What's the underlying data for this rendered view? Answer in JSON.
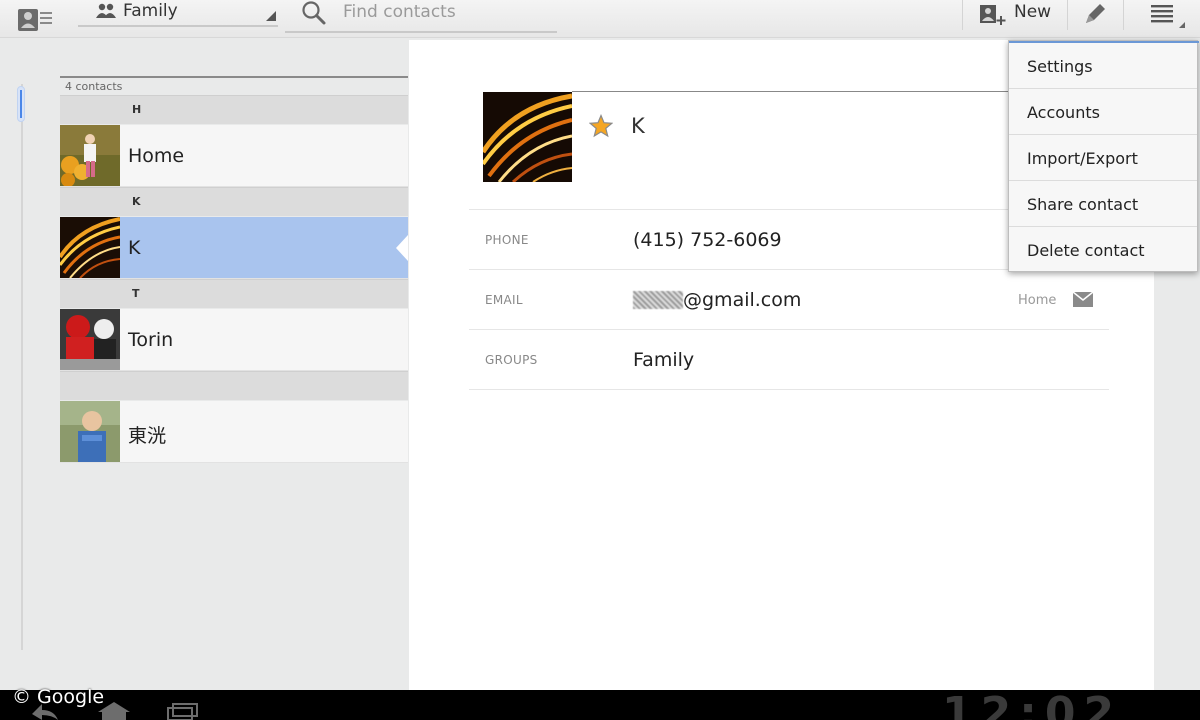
{
  "action_bar": {
    "group_label": "Family",
    "search_placeholder": "Find contacts",
    "new_label": "New"
  },
  "list": {
    "count_label": "4 contacts",
    "sections": [
      {
        "header": "H",
        "contacts": [
          {
            "name": "Home",
            "selected": false
          }
        ]
      },
      {
        "header": "K",
        "contacts": [
          {
            "name": "K",
            "selected": true
          }
        ]
      },
      {
        "header": "T",
        "contacts": [
          {
            "name": "Torin",
            "selected": false
          }
        ]
      },
      {
        "header": "",
        "contacts": [
          {
            "name": "東洸",
            "selected": false
          }
        ]
      }
    ]
  },
  "detail": {
    "name": "K",
    "starred": true,
    "fields": [
      {
        "label": "PHONE",
        "value": "(415) 752-6069",
        "type": ""
      },
      {
        "label": "EMAIL",
        "value": "@gmail.com",
        "type": "Home"
      },
      {
        "label": "GROUPS",
        "value": "Family",
        "type": ""
      }
    ]
  },
  "overflow_menu": {
    "items": [
      "Settings",
      "Accounts",
      "Import/Export",
      "Share contact",
      "Delete contact"
    ]
  },
  "system_bar": {
    "clock": "12:02"
  },
  "watermark": "© Google",
  "colors": {
    "selection": "#a9c4ee",
    "accent": "#4a86e8",
    "star": "#f5a623"
  },
  "icons": [
    "contacts-app-icon",
    "group-icon",
    "search-icon",
    "new-contact-icon",
    "edit-icon",
    "overflow-menu-icon",
    "star-icon",
    "mail-icon",
    "back-icon",
    "home-icon",
    "recent-apps-icon"
  ]
}
